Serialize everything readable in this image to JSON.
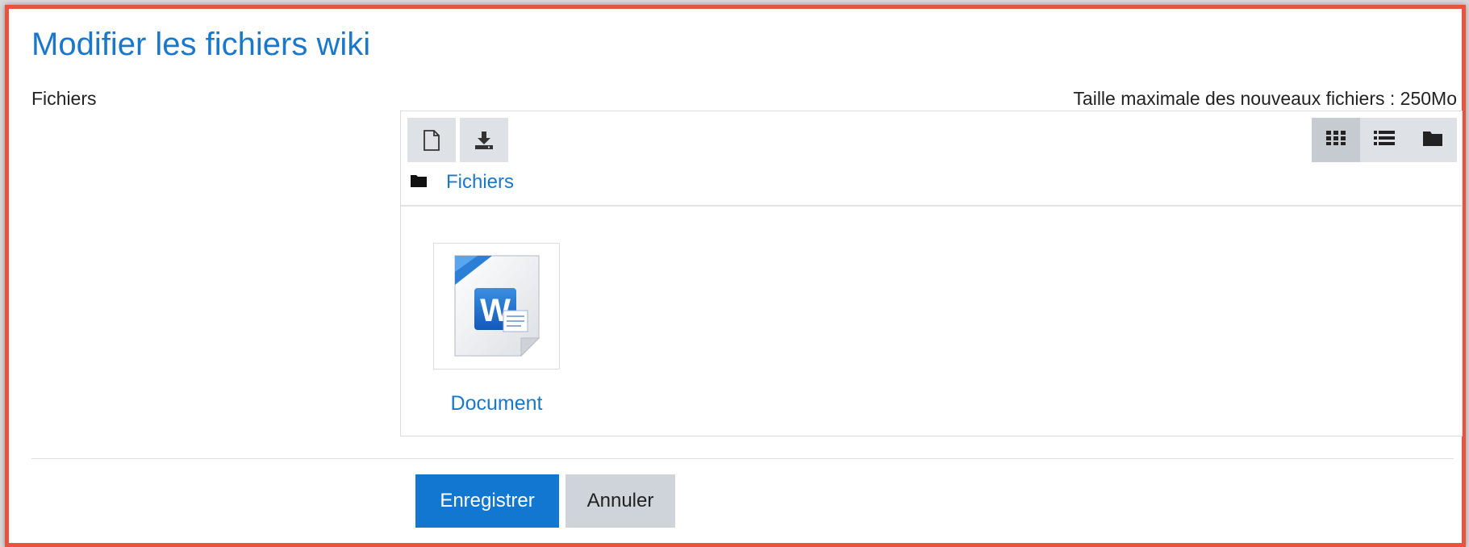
{
  "page": {
    "title": "Modifier les fichiers wiki"
  },
  "form": {
    "field_label": "Fichiers",
    "max_size_text": "Taille maximale des nouveaux fichiers : 250Mo"
  },
  "filemanager": {
    "toolbar": {
      "add_icon": "file-icon",
      "download_icon": "download-icon"
    },
    "view_modes": [
      {
        "name": "icons",
        "icon": "grid-icon",
        "active": true
      },
      {
        "name": "list",
        "icon": "list-icon",
        "active": false
      },
      {
        "name": "tree",
        "icon": "folder-icon",
        "active": false
      }
    ],
    "breadcrumb": {
      "icon": "folder-icon",
      "label": "Fichiers"
    },
    "files": [
      {
        "name": "Document",
        "icon": "word-document-icon"
      }
    ]
  },
  "buttons": {
    "save_label": "Enregistrer",
    "cancel_label": "Annuler"
  },
  "colors": {
    "accent": "#1a77c9",
    "primary_button": "#1177d1",
    "frame_border": "#e8533f",
    "secondary_button": "#ced4da"
  }
}
